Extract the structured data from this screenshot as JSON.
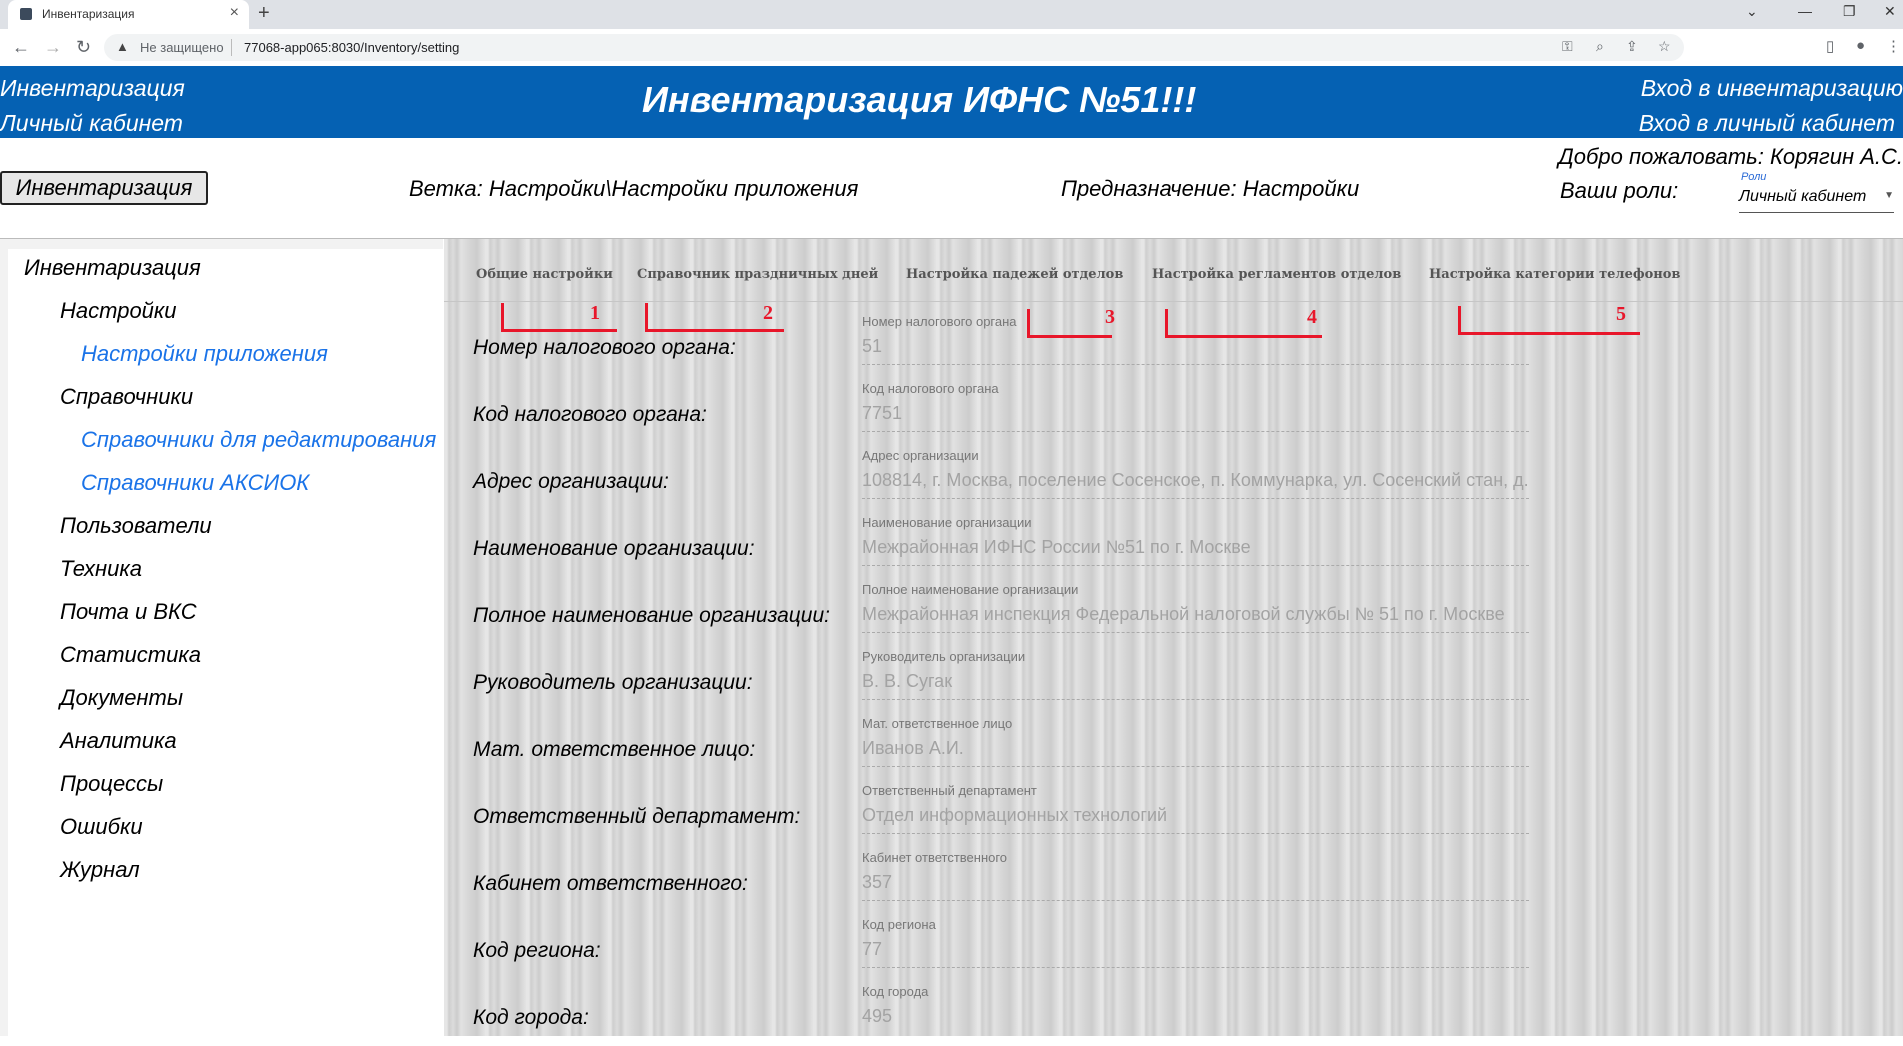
{
  "browser": {
    "tab_title": "Инвентаризация",
    "new_tab": "+",
    "not_secure": "Не защищено",
    "url": "77068-app065:8030/Inventory/setting"
  },
  "header": {
    "left_links": [
      "Инвентаризация",
      "Личный кабинет"
    ],
    "title": "Инвентаризация ИФНС №51!!!",
    "right_links": [
      "Вход в инвентаризацию",
      "Вход в личный кабинет"
    ]
  },
  "subbar": {
    "inventory_button": "Инвентаризация",
    "branch": "Ветка: Настройки\\Настройки приложения",
    "purpose": "Предназначение: Настройки",
    "welcome": "Добро пожаловать: Корягин А.С.",
    "roles_label": "Ваши роли:",
    "roles_small": "Роли",
    "roles_selected": "Личный кабинет"
  },
  "nav": {
    "root": "Инвентаризация",
    "settings": "Настройки",
    "app_settings": "Настройки приложения",
    "references": "Справочники",
    "editable_refs": "Справочники для редактирования",
    "aksiok_refs": "Справочники АКСИОК",
    "users": "Пользователи",
    "equipment": "Техника",
    "mail": "Почта и ВКС",
    "statistics": "Статистика",
    "documents": "Документы",
    "analytics": "Аналитика",
    "processes": "Процессы",
    "errors": "Ошибки",
    "journal": "Журнал"
  },
  "settings_tabs": [
    "Общие настройки",
    "Справочник праздничных дней",
    "Настройка падежей отделов",
    "Настройка регламентов отделов",
    "Настройка категории телефонов"
  ],
  "annotations": [
    "1",
    "2",
    "3",
    "4",
    "5"
  ],
  "fields": [
    {
      "label": "Номер налогового органа:",
      "small": "Номер налогового органа",
      "value": "51"
    },
    {
      "label": "Код налогового органа:",
      "small": "Код налогового органа",
      "value": "7751"
    },
    {
      "label": "Адрес организации:",
      "small": "Адрес организации",
      "value": "108814, г. Москва, поселение Сосенское, п. Коммунарка, ул. Сосенский стан, д."
    },
    {
      "label": "Наименование организации:",
      "small": "Наименование организации",
      "value": "Межрайонная ИФНС России №51 по г. Москве"
    },
    {
      "label": "Полное наименование организации:",
      "small": "Полное наименование организации",
      "value": "Межрайонная инспекция Федеральной налоговой службы № 51 по г. Москве"
    },
    {
      "label": "Руководитель организации:",
      "small": "Руководитель организации",
      "value": "В. В. Сугак"
    },
    {
      "label": "Мат. ответственное лицо:",
      "small": "Мат. ответственное лицо",
      "value": "Иванов А.И."
    },
    {
      "label": "Ответственный департамент:",
      "small": "Ответственный департамент",
      "value": "Отдел информационных технологий"
    },
    {
      "label": "Кабинет ответственного:",
      "small": "Кабинет ответственного",
      "value": "357"
    },
    {
      "label": "Код региона:",
      "small": "Код региона",
      "value": "77"
    },
    {
      "label": "Код города:",
      "small": "Код города",
      "value": "495"
    }
  ],
  "colors": {
    "header_bg": "#0561b3",
    "link": "#1a73e8",
    "annotation": "#e8162a"
  }
}
